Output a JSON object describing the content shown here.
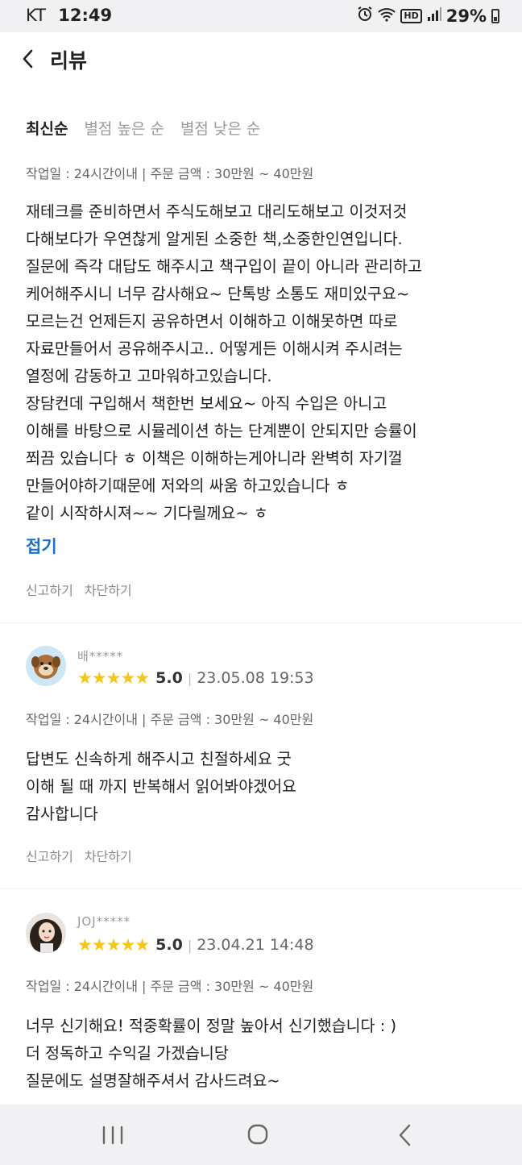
{
  "status_bar": {
    "carrier": "KT",
    "time": "12:49",
    "hd": "HD",
    "battery": "29%"
  },
  "header": {
    "title": "리뷰"
  },
  "sort": {
    "options": [
      "최신순",
      "별점 높은 순",
      "별점 낮은 순"
    ],
    "active": "최신순"
  },
  "reviews": [
    {
      "meta": "작업일 : 24시간이내 | 주문 금액 : 30만원 ~ 40만원",
      "body": "재테크를 준비하면서 주식도해보고 대리도해보고 이것저것\n다해보다가 우연찮게 알게된 소중한 책,소중한인연입니다.\n질문에 즉각 대답도 해주시고 책구입이 끝이 아니라 관리하고\n케어해주시니 너무 감사해요~ 단톡방 소통도 재미있구요~\n모르는건 언제든지 공유하면서 이해하고 이해못하면 따로\n자료만들어서 공유해주시고.. 어떻게든 이해시켜 주시려는\n열정에 감동하고 고마워하고있습니다.\n장담컨데 구입해서 책한번 보세요~ 아직 수입은 아니고\n이해를 바탕으로 시뮬레이션 하는 단계뿐이 안되지만 승률이\n쬐끔 있습니다 ㅎ 이책은 이해하는게아니라 완벽히 자기껄\n만들어야하기때문에 저와의 싸움 하고있습니다 ㅎ\n같이 시작하시져~~  기다릴께요~ ㅎ",
      "fold": "접기",
      "report": "신고하기",
      "block": "차단하기"
    },
    {
      "username": "배*****",
      "stars": "★★★★★",
      "score": "5.0",
      "date": "23.05.08 19:53",
      "meta": "작업일 : 24시간이내 | 주문 금액 : 30만원 ~ 40만원",
      "body": "답변도 신속하게 해주시고 친절하세요 굿\n이해 될 때 까지 반복해서 읽어봐야겠어요\n감사합니다",
      "report": "신고하기",
      "block": "차단하기"
    },
    {
      "username": "JOJ*****",
      "stars": "★★★★★",
      "score": "5.0",
      "date": "23.04.21 14:48",
      "meta": "작업일 : 24시간이내 | 주문 금액 : 30만원 ~ 40만원",
      "body": "너무 신기해요!  적중확률이 정말 높아서 신기했습니다 : )\n더 정독하고 수익길 가겠습니당\n질문에도 설명잘해주셔서 감사드려요~"
    }
  ],
  "colors": {
    "accent": "#1a6fd0",
    "star": "#f5c518",
    "status_bg": "#f1f1f3"
  }
}
